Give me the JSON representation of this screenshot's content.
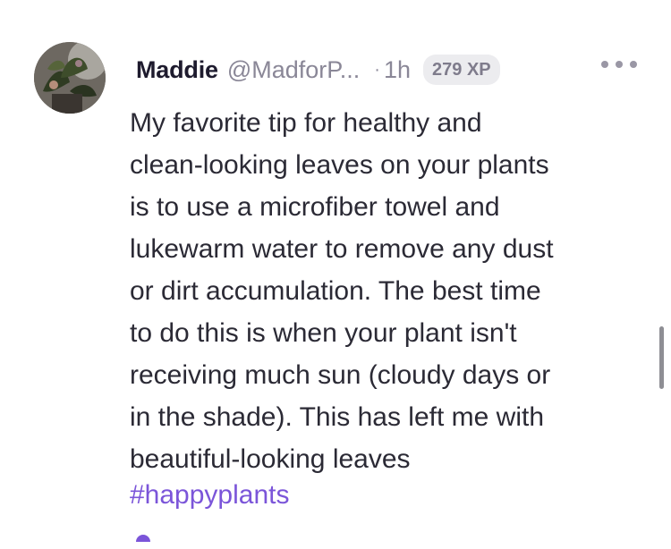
{
  "post": {
    "author_name": "Maddie",
    "author_handle": "@MadforP...",
    "separator": "·",
    "timestamp": "1h",
    "xp_badge": "279 XP",
    "body": "My favorite tip for healthy and\nclean-looking leaves on your plants\nis to use a microfiber towel and\nlukewarm water to remove any dust\nor dirt accumulation. The best time\nto do this is when your plant isn't\nreceiving much sun (cloudy days or\nin the shade). This has left me with\nbeautiful-looking leaves",
    "hashtag": "#happyplants"
  },
  "icons": {
    "more": "more-options-icon",
    "avatar": "plant-avatar"
  },
  "colors": {
    "accent": "#7b55d9",
    "name": "#1e1b2e",
    "muted": "#8a8797",
    "badge_bg": "#ececef"
  }
}
